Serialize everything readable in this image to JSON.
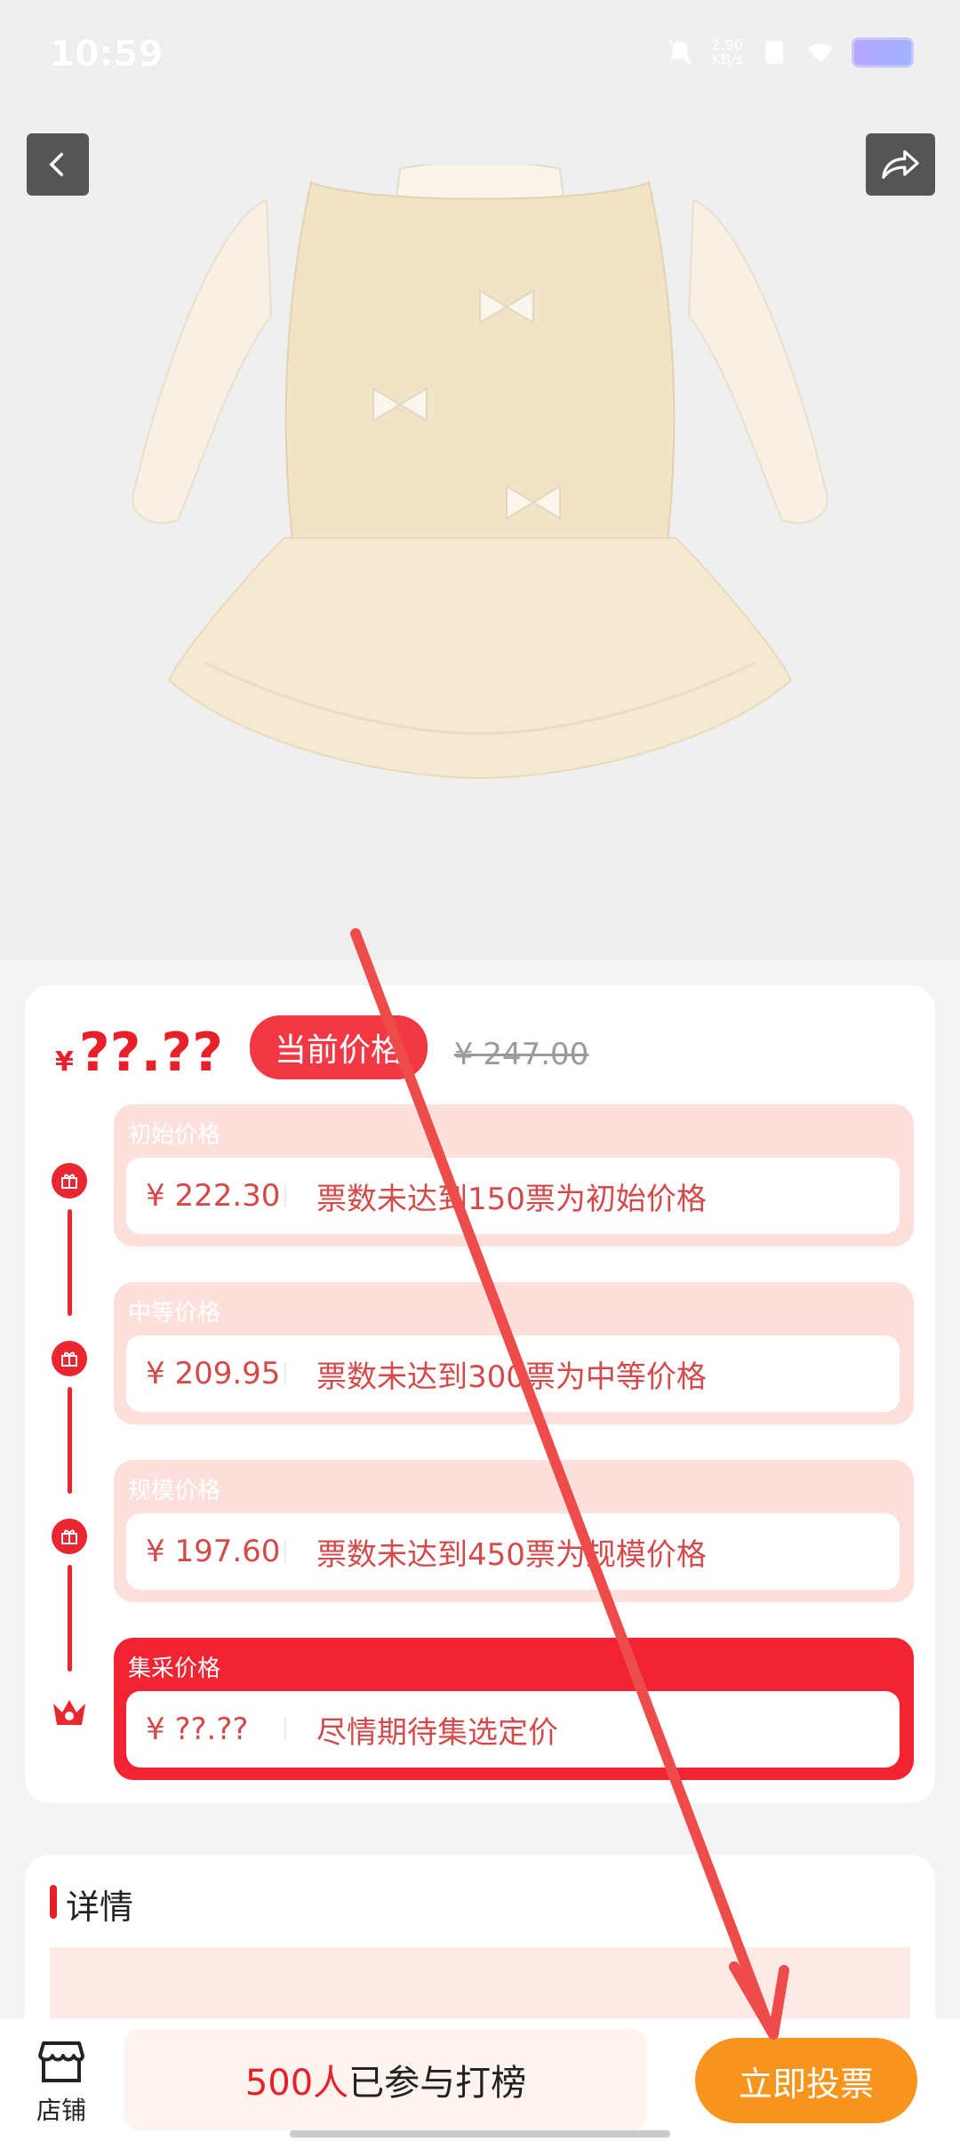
{
  "status": {
    "time": "10:59",
    "net_speed_top": "2.90",
    "net_speed_bottom": "KB/s"
  },
  "hero": {
    "back_icon": "chevron-left-icon",
    "share_icon": "share-arrow-icon"
  },
  "price_card": {
    "current_price_yen": "¥",
    "current_price": "??.??",
    "current_label": "当前价格",
    "original_price": "¥ 247.00",
    "tiers": [
      {
        "name": "初始价格",
        "price": "¥ 222.30",
        "desc": "票数未达到150票为初始价格"
      },
      {
        "name": "中等价格",
        "price": "¥ 209.95",
        "desc": "票数未达到300票为中等价格"
      },
      {
        "name": "规模价格",
        "price": "¥ 197.60",
        "desc": "票数未达到450票为规模价格"
      },
      {
        "name": "集采价格",
        "price": "¥ ??.??",
        "desc": "尽情期待集选定价"
      }
    ]
  },
  "details": {
    "title": "详情"
  },
  "bottom_bar": {
    "store_label": "店铺",
    "joined_count": "500人",
    "joined_text": "已参与打榜",
    "vote_button": "立即投票"
  },
  "colors": {
    "accent_red": "#e8202a",
    "vote_orange": "#f7941d",
    "tier_bg": "#fde0dc"
  }
}
